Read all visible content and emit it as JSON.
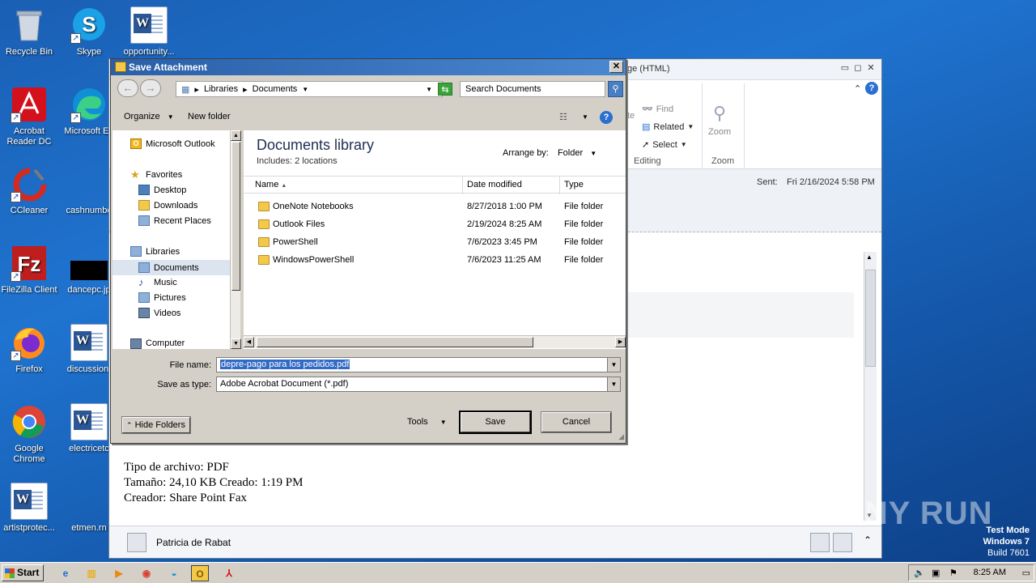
{
  "desktop": {
    "icons": [
      {
        "label": "Recycle Bin",
        "icon": "recycle-bin-icon"
      },
      {
        "label": "Skype",
        "icon": "skype-icon"
      },
      {
        "label": "opportunity...",
        "icon": "word-doc-icon"
      },
      {
        "label": "Acrobat Reader DC",
        "icon": "acrobat-icon"
      },
      {
        "label": "Microsoft Ed",
        "icon": "edge-icon"
      },
      {
        "label": "CCleaner",
        "icon": "ccleaner-icon"
      },
      {
        "label": "cashnumbe",
        "icon": "file-icon"
      },
      {
        "label": "FileZilla Client",
        "icon": "filezilla-icon"
      },
      {
        "label": "dancepc.jp",
        "icon": "image-icon"
      },
      {
        "label": "Firefox",
        "icon": "firefox-icon"
      },
      {
        "label": "discussiont",
        "icon": "word-doc-icon"
      },
      {
        "label": "Google Chrome",
        "icon": "chrome-icon"
      },
      {
        "label": "electricetc",
        "icon": "word-doc-icon"
      },
      {
        "label": "artistprotec...",
        "icon": "word-doc-icon"
      },
      {
        "label": "etmen.rn",
        "icon": "file-icon"
      }
    ]
  },
  "outlook": {
    "title_fragment": "ge (HTML)",
    "ribbon": {
      "find": "Find",
      "related": "Related",
      "select": "Select",
      "editing_label": "Editing",
      "zoom": "Zoom",
      "zoom_label": "Zoom",
      "te_fragment": "te"
    },
    "sent_label": "Sent:",
    "sent_value": "Fri 2/16/2024 5:58 PM",
    "body_lines": [
      "Tipo de archivo: PDF",
      "Tamaño: 24,10 KB Creado: 1:19 PM",
      "Creador: Share Point Fax"
    ],
    "sender": "Patricia de Rabat"
  },
  "dialog": {
    "title": "Save Attachment",
    "close": "✕",
    "breadcrumb": [
      "Libraries",
      "Documents"
    ],
    "search_placeholder": "Search Documents",
    "toolbar": {
      "organize": "Organize",
      "new_folder": "New folder"
    },
    "nav": {
      "microsoft_outlook": "Microsoft Outlook",
      "favorites": "Favorites",
      "desktop": "Desktop",
      "downloads": "Downloads",
      "recent_places": "Recent Places",
      "libraries": "Libraries",
      "documents": "Documents",
      "music": "Music",
      "pictures": "Pictures",
      "videos": "Videos",
      "computer": "Computer"
    },
    "library_title": "Documents library",
    "library_subtitle": "Includes:  2 locations",
    "arrange_label": "Arrange by:",
    "arrange_value": "Folder",
    "columns": {
      "name": "Name",
      "date": "Date modified",
      "type": "Type"
    },
    "files": [
      {
        "name": "OneNote Notebooks",
        "date": "8/27/2018 1:00 PM",
        "type": "File folder"
      },
      {
        "name": "Outlook Files",
        "date": "2/19/2024 8:25 AM",
        "type": "File folder"
      },
      {
        "name": "PowerShell",
        "date": "7/6/2023 3:45 PM",
        "type": "File folder"
      },
      {
        "name": "WindowsPowerShell",
        "date": "7/6/2023 11:25 AM",
        "type": "File folder"
      }
    ],
    "file_name_label": "File name:",
    "file_name_value": "depre-pago para los pedidos.pdf",
    "save_type_label": "Save as type:",
    "save_type_value": "Adobe Acrobat Document (*.pdf)",
    "hide_folders": "Hide Folders",
    "tools": "Tools",
    "save": "Save",
    "cancel": "Cancel"
  },
  "taskbar": {
    "start": "Start",
    "clock": "8:25 AM"
  },
  "watermark": {
    "line1": "Test Mode",
    "line2": "Windows 7",
    "line3": "Build 7601",
    "brand": "ANY RUN"
  }
}
